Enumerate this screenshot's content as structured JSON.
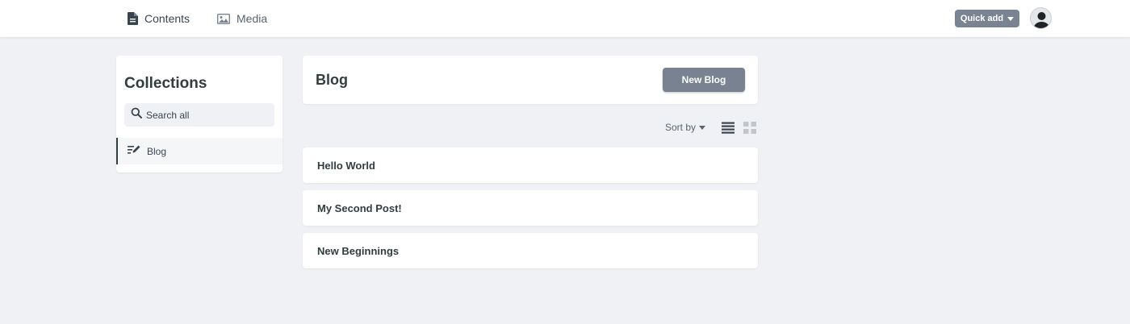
{
  "topbar": {
    "nav": [
      {
        "label": "Contents",
        "icon": "document-icon"
      },
      {
        "label": "Media",
        "icon": "image-icon"
      }
    ],
    "quick_add_label": "Quick add"
  },
  "sidebar": {
    "title": "Collections",
    "search_placeholder": "Search all",
    "items": [
      {
        "label": "Blog",
        "icon": "edit-list-icon",
        "active": true
      }
    ]
  },
  "main": {
    "title": "Blog",
    "new_button_label": "New Blog",
    "sort_label": "Sort by",
    "entries": [
      {
        "title": "Hello World"
      },
      {
        "title": "My Second Post!"
      },
      {
        "title": "New Beginnings"
      }
    ]
  },
  "colors": {
    "background": "#eff1f4",
    "button": "#798291",
    "text": "#313d3e"
  }
}
